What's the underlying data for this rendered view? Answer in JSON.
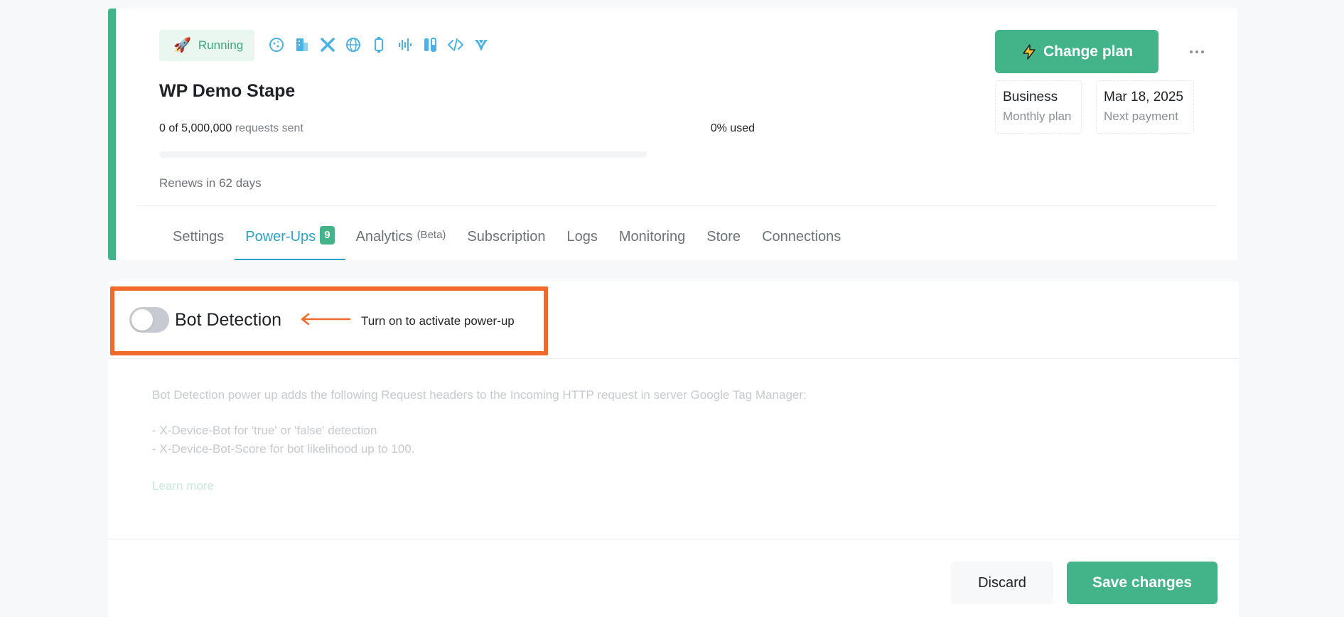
{
  "container": {
    "status": "Running",
    "title": "WP Demo Stape",
    "requests_count": "0 of 5,000,000",
    "requests_label": "requests sent",
    "used": "0% used",
    "used_fraction": 0,
    "renews": "Renews in 62 days",
    "powerup_icons": [
      "cookie-icon",
      "building-icon",
      "tools-icon",
      "globe-icon",
      "device-icon",
      "waveform-icon",
      "flask-icon",
      "code-icon",
      "bird-icon"
    ]
  },
  "plan": {
    "change_label": "Change plan",
    "name": "Business",
    "period": "Monthly plan",
    "next_date": "Mar 18, 2025",
    "next_label": "Next payment"
  },
  "tabs": [
    {
      "label": "Settings"
    },
    {
      "label": "Power-Ups",
      "badge": "9",
      "active": true
    },
    {
      "label": "Analytics",
      "suffix": "(Beta)"
    },
    {
      "label": "Subscription"
    },
    {
      "label": "Logs"
    },
    {
      "label": "Monitoring"
    },
    {
      "label": "Store"
    },
    {
      "label": "Connections"
    }
  ],
  "powerup": {
    "title": "Bot Detection",
    "hint": "Turn on to activate power-up",
    "enabled": false,
    "description_intro": "Bot Detection power up adds the following Request headers to the Incoming HTTP request in server Google Tag Manager:",
    "description_items": [
      "- X-Device-Bot for 'true' or 'false' detection",
      "- X-Device-Bot-Score for bot likelihood up to 100."
    ],
    "learn_more": "Learn more"
  },
  "footer": {
    "discard_label": "Discard",
    "save_label": "Save changes"
  },
  "colors": {
    "accent_green": "#43b389",
    "active_tab_blue": "#2aa3cc",
    "highlight_orange": "#f06a2c",
    "icon_blue": "#4ab3e6"
  }
}
